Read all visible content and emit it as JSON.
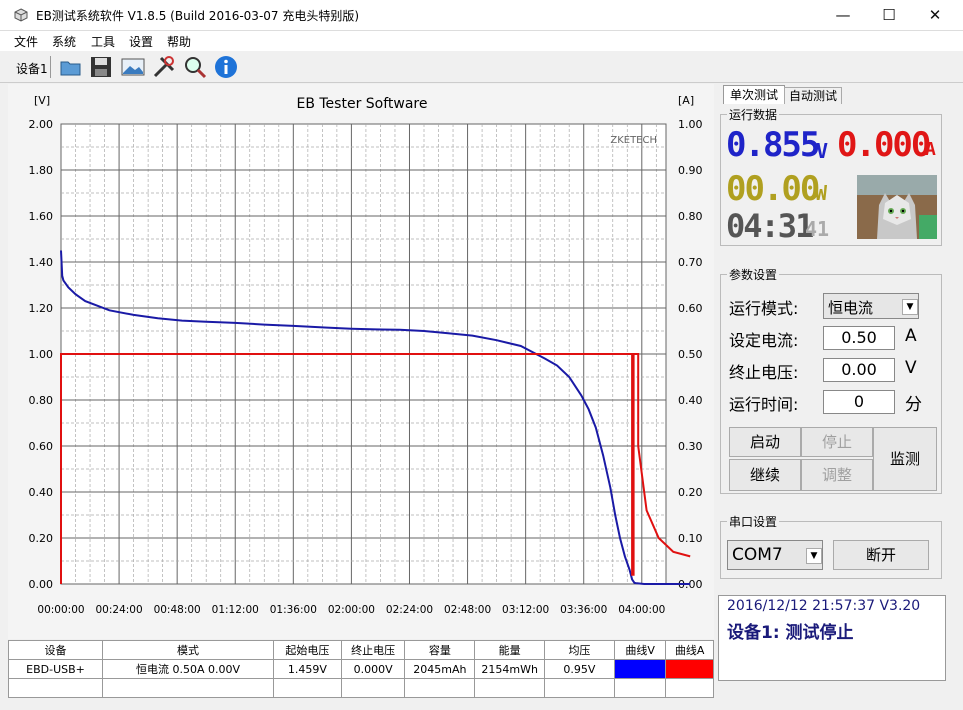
{
  "window": {
    "title": "EB测试系统软件 V1.8.5 (Build 2016-03-07 充电头特别版)",
    "min_glyph": "—",
    "max_glyph": "☐",
    "close_glyph": "✕"
  },
  "menu": [
    "文件",
    "系统",
    "工具",
    "设置",
    "帮助"
  ],
  "toolbar": {
    "device_label": "设备1"
  },
  "chart_data": {
    "type": "line",
    "title": "EB Tester Software",
    "ylabel_left": "[V]",
    "ylabel_right": "[A]",
    "watermark": "ZKETECH",
    "ylim_left": [
      0,
      2.0
    ],
    "ylim_right": [
      0,
      1.0
    ],
    "yticks_left": [
      "2.00",
      "1.80",
      "1.60",
      "1.40",
      "1.20",
      "1.00",
      "0.80",
      "0.60",
      "0.40",
      "0.20",
      "0.00"
    ],
    "yticks_right": [
      "1.00",
      "0.90",
      "0.80",
      "0.70",
      "0.60",
      "0.50",
      "0.40",
      "0.30",
      "0.20",
      "0.10",
      "0.00"
    ],
    "xticks": [
      "00:00:00",
      "00:24:00",
      "00:48:00",
      "01:12:00",
      "01:36:00",
      "02:00:00",
      "02:24:00",
      "02:48:00",
      "03:12:00",
      "03:36:00",
      "04:00:00"
    ],
    "x_unit_minutes": [
      0,
      24,
      48,
      72,
      96,
      120,
      144,
      168,
      192,
      216,
      240
    ],
    "series": [
      {
        "name": "曲线V",
        "axis": "left",
        "color": "#1a1aa6",
        "x": [
          0,
          0.5,
          1,
          3,
          6,
          10,
          15,
          20,
          30,
          40,
          50,
          60,
          72,
          84,
          96,
          110,
          120,
          130,
          140,
          150,
          160,
          170,
          180,
          190,
          200,
          205,
          210,
          215,
          218,
          221,
          224,
          227,
          229,
          231,
          233,
          235,
          236,
          237,
          238,
          239,
          240,
          241,
          250,
          260
        ],
        "y": [
          1.45,
          1.34,
          1.32,
          1.29,
          1.26,
          1.23,
          1.21,
          1.19,
          1.17,
          1.155,
          1.145,
          1.14,
          1.135,
          1.128,
          1.122,
          1.115,
          1.11,
          1.107,
          1.105,
          1.1,
          1.09,
          1.08,
          1.06,
          1.035,
          0.98,
          0.95,
          0.9,
          0.82,
          0.76,
          0.68,
          0.56,
          0.42,
          0.3,
          0.2,
          0.12,
          0.06,
          0.02,
          0.005,
          0.003,
          0.002,
          0.001,
          0.0,
          0.0,
          0.0
        ]
      },
      {
        "name": "曲线A",
        "axis": "right",
        "color": "#e01010",
        "x": [
          0,
          0,
          0.3,
          236,
          236,
          236.6,
          236.6,
          237,
          238.5,
          238.5,
          239.5,
          242,
          247,
          253,
          260
        ],
        "y": [
          0,
          0.5,
          0.5,
          0.5,
          0.02,
          0.02,
          0.5,
          0.5,
          0.5,
          0.3,
          0.26,
          0.16,
          0.1,
          0.07,
          0.06
        ]
      }
    ]
  },
  "result_table": {
    "headers": [
      "设备",
      "模式",
      "起始电压",
      "终止电压",
      "容量",
      "能量",
      "均压",
      "曲线V",
      "曲线A"
    ],
    "row": [
      "EBD-USB+",
      "恒电流  0.50A  0.00V",
      "1.459V",
      "0.000V",
      "2045mAh",
      "2154mWh",
      "0.95V",
      "",
      ""
    ],
    "curve_v_color": "#0000ff",
    "curve_a_color": "#ff0000"
  },
  "panel": {
    "tab_single": "单次测试",
    "tab_auto": "自动测试",
    "run_data_title": "运行数据",
    "voltage": "0.855",
    "voltage_unit": "V",
    "current": "0.000",
    "current_unit": "A",
    "power": "00.00",
    "power_unit": "W",
    "time": "04:31",
    "time_sec": "41",
    "params_title": "参数设置",
    "mode_label": "运行模式:",
    "mode_value": "恒电流",
    "set_current_label": "设定电流:",
    "set_current_value": "0.50",
    "set_current_unit": "A",
    "stop_voltage_label": "终止电压:",
    "stop_voltage_value": "0.00",
    "stop_voltage_unit": "V",
    "run_time_label": "运行时间:",
    "run_time_value": "0",
    "run_time_unit": "分",
    "btn_start": "启动",
    "btn_stop": "停止",
    "btn_monitor": "监测",
    "btn_continue": "继续",
    "btn_adjust": "调整",
    "serial_title": "串口设置",
    "serial_port": "COM7",
    "btn_disconnect": "断开",
    "status_line1": "2016/12/12 21:57:37  V3.20",
    "status_line2": "设备1: 测试停止"
  }
}
